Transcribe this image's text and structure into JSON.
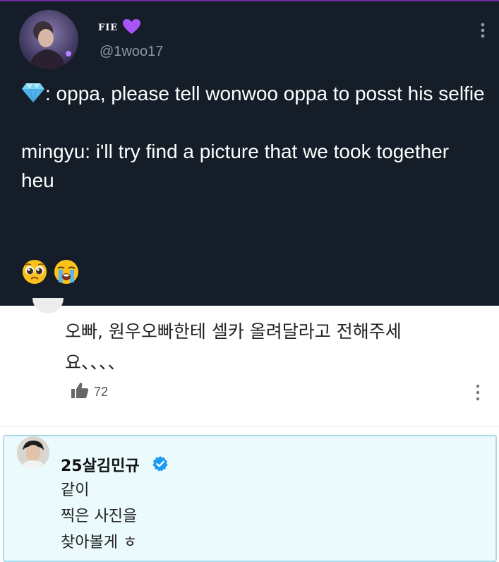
{
  "tweet": {
    "display_name": "FIE",
    "name_emoji": "purple-heart-icon",
    "handle": "@1woo17",
    "body_line1": ": oppa, please tell wonwoo oppa to posst his selfie",
    "body_line1_emoji": "gem-stone-icon",
    "body_line2": "mingyu: i'll try find a picture that we took together heu",
    "trailing_emojis": [
      "pleading-face-icon",
      "loudly-crying-face-icon"
    ],
    "more_icon": "more-vertical-icon",
    "colors": {
      "background": "#151d28",
      "handle": "#8b98a5",
      "accent": "#9b5de5"
    }
  },
  "comment": {
    "text": "오빠, 원우오빠한테 셀카 올려달라고 전해주세요、、、、",
    "like_icon": "thumbs-up-icon",
    "like_count": "72",
    "more_icon": "more-vertical-icon"
  },
  "reply": {
    "name": "25살김민규",
    "badge": "verified-icon",
    "lines": [
      "같이",
      "찍은 사진을",
      "찾아볼게 ㅎ"
    ],
    "colors": {
      "background": "#ebfafd",
      "border": "#a9dcea",
      "badge": "#1d9bf0"
    }
  }
}
